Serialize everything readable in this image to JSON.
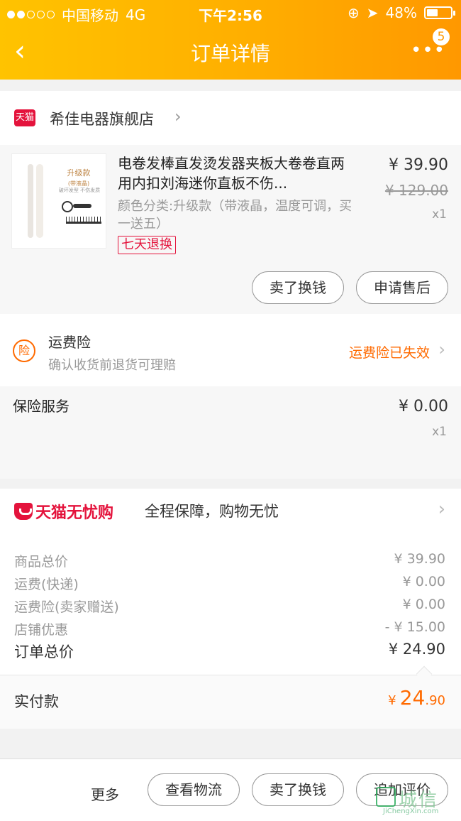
{
  "status_bar": {
    "carrier": "中国移动",
    "network": "4G",
    "time": "下午2:56",
    "battery": "48%",
    "battery_level": 0.48
  },
  "nav": {
    "back_icon": "chevron-left-icon",
    "title": "订单详情",
    "more_icon": "more-dots-icon",
    "badge": "5"
  },
  "store": {
    "logo_text": "天猫",
    "name": "希佳电器旗舰店"
  },
  "product": {
    "image_label": "升级款",
    "image_sublabel": "(带液晶)",
    "image_caption": "破坏发型 不伤发质",
    "title": "电卷发棒直发烫发器夹板大卷卷直两用内扣刘海迷你直板不伤...",
    "sku": "颜色分类:升级款（带液晶，温度可调，买一送五）",
    "tag": "七天退换",
    "price": "¥ 39.90",
    "original_price": "¥ 129.00",
    "quantity": "x1",
    "actions": [
      "卖了换钱",
      "申请售后"
    ]
  },
  "insurance": {
    "icon_text": "险",
    "title": "运费险",
    "subtitle": "确认收货前退货可理赔",
    "status": "运费险已失效"
  },
  "service": {
    "title": "保险服务",
    "price": "¥ 0.00",
    "quantity": "x1"
  },
  "assurance": {
    "brand": "天猫无忧购",
    "text": "全程保障，购物无忧"
  },
  "summary": {
    "rows": [
      {
        "label": "商品总价",
        "value": "¥ 39.90"
      },
      {
        "label": "运费(快递)",
        "value": "¥ 0.00"
      },
      {
        "label": "运费险(卖家赠送)",
        "value": "¥ 0.00"
      },
      {
        "label": "店铺优惠",
        "value": "- ¥ 15.00"
      }
    ],
    "total_label": "订单总价",
    "total_value": "¥ 24.90"
  },
  "paid": {
    "label": "实付款",
    "currency": "¥",
    "integer": "24",
    "decimal": ".90"
  },
  "bottom": {
    "more": "更多",
    "buttons": [
      "查看物流",
      "卖了换钱",
      "追加评价"
    ]
  },
  "watermark": {
    "text": "城信",
    "sub": "JiChengXin.com"
  },
  "colors": {
    "header_start": "#ffc300",
    "header_end": "#ff9800",
    "accent_orange": "#ff6a00",
    "tmall_red": "#e4133c"
  }
}
